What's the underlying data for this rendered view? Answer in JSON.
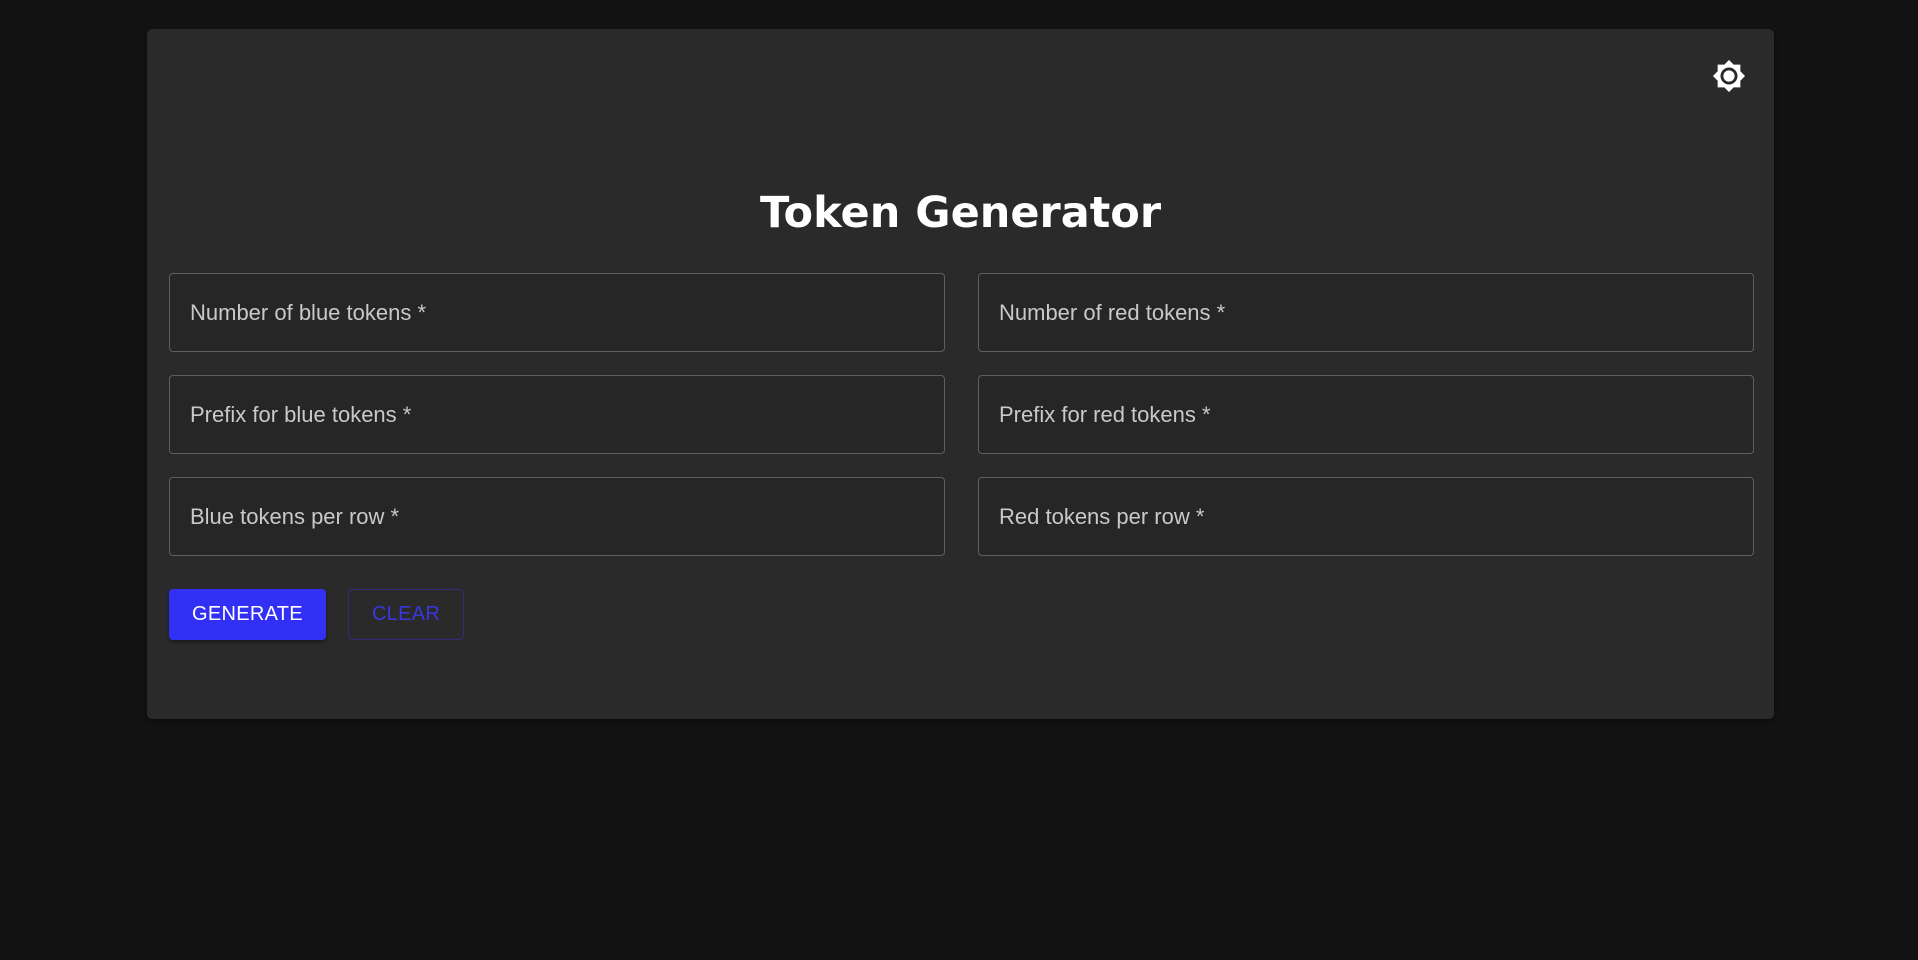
{
  "page": {
    "title": "Token Generator",
    "theme_toggle_icon": "brightness-icon"
  },
  "form": {
    "fields": [
      {
        "id": "blue-count",
        "placeholder": "Number of blue tokens *",
        "value": ""
      },
      {
        "id": "red-count",
        "placeholder": "Number of red tokens *",
        "value": ""
      },
      {
        "id": "blue-prefix",
        "placeholder": "Prefix for blue tokens *",
        "value": ""
      },
      {
        "id": "red-prefix",
        "placeholder": "Prefix for red tokens *",
        "value": ""
      },
      {
        "id": "blue-per-row",
        "placeholder": "Blue tokens per row *",
        "value": ""
      },
      {
        "id": "red-per-row",
        "placeholder": "Red tokens per row *",
        "value": ""
      }
    ]
  },
  "actions": {
    "generate_label": "GENERATE",
    "clear_label": "CLEAR"
  },
  "colors": {
    "background": "#121212",
    "card": "#2a2a2a",
    "primary": "#3330f5"
  }
}
